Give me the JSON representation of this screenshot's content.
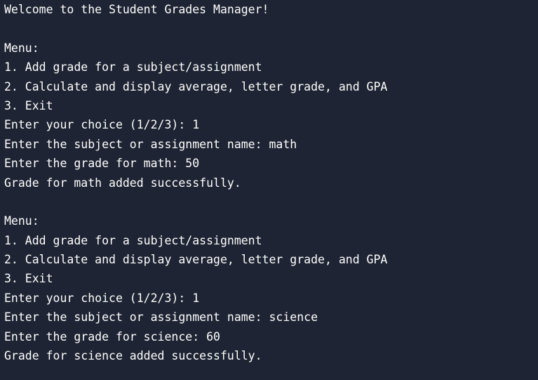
{
  "terminal": {
    "lines": [
      "Welcome to the Student Grades Manager!",
      "",
      "Menu:",
      "1. Add grade for a subject/assignment",
      "2. Calculate and display average, letter grade, and GPA",
      "3. Exit",
      "Enter your choice (1/2/3): 1",
      "Enter the subject or assignment name: math",
      "Enter the grade for math: 50",
      "Grade for math added successfully.",
      "",
      "Menu:",
      "1. Add grade for a subject/assignment",
      "2. Calculate and display average, letter grade, and GPA",
      "3. Exit",
      "Enter your choice (1/2/3): 1",
      "Enter the subject or assignment name: science",
      "Enter the grade for science: 60",
      "Grade for science added successfully.",
      ""
    ]
  }
}
